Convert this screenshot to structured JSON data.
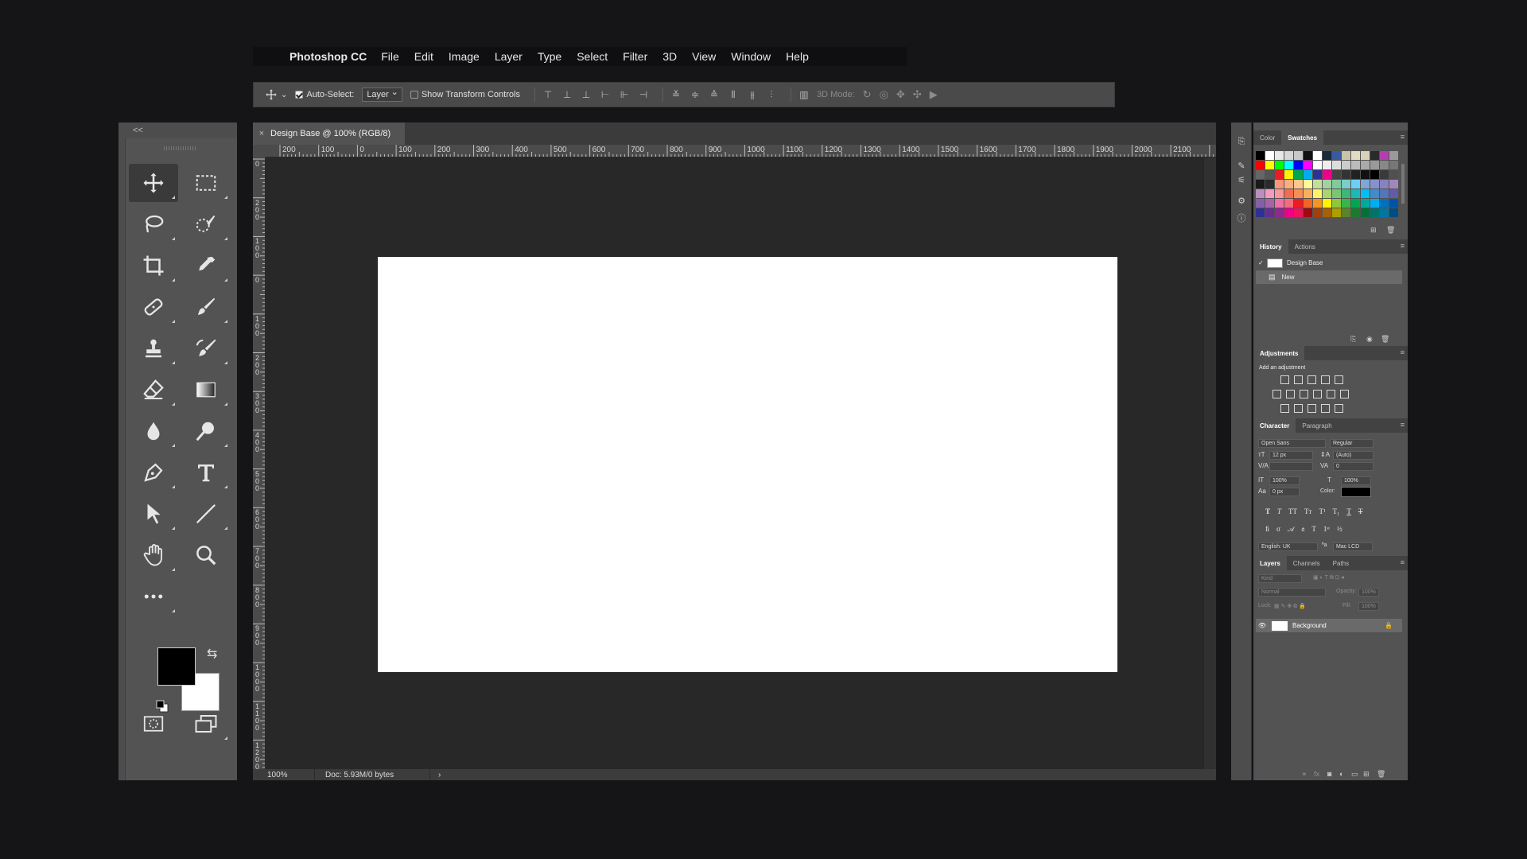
{
  "menubar": {
    "apple": "",
    "app_name": "Photoshop CC",
    "items": [
      "File",
      "Edit",
      "Image",
      "Layer",
      "Type",
      "Select",
      "Filter",
      "3D",
      "View",
      "Window",
      "Help"
    ]
  },
  "options": {
    "auto_select_label": "Auto-Select:",
    "auto_select_value": "Layer",
    "transform_label": "Show Transform Controls",
    "mode3d_label": "3D Mode:"
  },
  "tools": {
    "collapse": "<<"
  },
  "document": {
    "tab_close": "×",
    "tab_title": "Design Base @ 100% (RGB/8)",
    "ruler_h": [
      "200",
      "100",
      "0",
      "100",
      "200",
      "300",
      "400",
      "500",
      "600",
      "700",
      "800",
      "900",
      "1000",
      "1100",
      "1200",
      "1300",
      "1400",
      "1500",
      "1600",
      "1700",
      "1800",
      "1900",
      "2000",
      "2100"
    ],
    "ruler_v": [
      "0",
      "200",
      "100",
      "0",
      "100",
      "200",
      "300",
      "400",
      "500",
      "600",
      "700",
      "800",
      "900",
      "1000",
      "1100",
      "1200",
      "1"
    ],
    "zoom": "100%",
    "doc_info": "Doc: 5.93M/0 bytes",
    "status_arrow": "›"
  },
  "panels": {
    "color_tab": "Color",
    "swatches_tab": "Swatches",
    "history_tab": "History",
    "actions_tab": "Actions",
    "history_items": [
      "Design Base",
      "New"
    ],
    "adjustments_tab": "Adjustments",
    "add_adjustment": "Add an adjustment",
    "character_tab": "Character",
    "paragraph_tab": "Paragraph",
    "font_family": "Open Sans",
    "font_style": "Regular",
    "font_size": "12 px",
    "leading": "(Auto)",
    "tracking": "0",
    "vscale": "100%",
    "hscale": "100%",
    "baseline": "0 px",
    "color_label": "Color:",
    "language": "English: UK",
    "antialias": "Mac LCD",
    "layers_tab": "Layers",
    "channels_tab": "Channels",
    "paths_tab": "Paths",
    "kind_placeholder": "Kind",
    "blend_mode": "Normal",
    "opacity_label": "Opacity:",
    "opacity_value": "100%",
    "lock_label": "Lock:",
    "fill_label": "Fill:",
    "fill_value": "100%",
    "layer_name": "Background"
  },
  "colors": {
    "foreground": "#000000",
    "background": "#ffffff",
    "swatches": [
      "#000000",
      "#ffffff",
      "#e8e8e8",
      "#d6d6d6",
      "#c8c8c8",
      "#111111",
      "#ffffff",
      "#1b2a3a",
      "#3a5aa0",
      "#c9c3a8",
      "#e3dcc4",
      "#d8d2ba",
      "#2a2a2a",
      "#b040b0",
      "#9a9a9a",
      "#ff0000",
      "#ffff00",
      "#00ff00",
      "#00ffff",
      "#0000ff",
      "#ff00ff",
      "#ffffff",
      "#eeeeee",
      "#dddddd",
      "#cccccc",
      "#bbbbbb",
      "#aaaaaa",
      "#999999",
      "#888888",
      "#777777",
      "#666666",
      "#555555",
      "#ed1c24",
      "#fff200",
      "#00a651",
      "#00aeef",
      "#2e3192",
      "#ec008c",
      "#444444",
      "#333333",
      "#222222",
      "#111111",
      "#000000",
      "#3a3a3a",
      "#505050",
      "#1a1a1a",
      "#2a2a2a",
      "#f7977a",
      "#f9ad81",
      "#fdc68a",
      "#fff79a",
      "#c4df9b",
      "#a3d39c",
      "#82ca9d",
      "#7bcdc8",
      "#6ecff6",
      "#7ea7d8",
      "#8493ca",
      "#8882be",
      "#a187be",
      "#bc8dbf",
      "#f49ac2",
      "#f6989d",
      "#f26c4f",
      "#f68e55",
      "#fbaf5c",
      "#fff467",
      "#acd372",
      "#7cc576",
      "#3bb878",
      "#1abbb4",
      "#00bff3",
      "#438ccb",
      "#5574b9",
      "#605ca8",
      "#855fa8",
      "#a763a8",
      "#f06ea9",
      "#f26d7d",
      "#ed1c24",
      "#f26522",
      "#f7941d",
      "#fff200",
      "#8dc73f",
      "#39b54a",
      "#00a651",
      "#00a99d",
      "#00aeef",
      "#0072bc",
      "#0054a6",
      "#2e3192",
      "#662d91",
      "#92278f",
      "#ec008c",
      "#ed145b",
      "#9e0b0f",
      "#a0410d",
      "#a36209",
      "#aba000",
      "#598527",
      "#1a7b30",
      "#007236",
      "#00746b",
      "#0076a3",
      "#004b80"
    ]
  }
}
